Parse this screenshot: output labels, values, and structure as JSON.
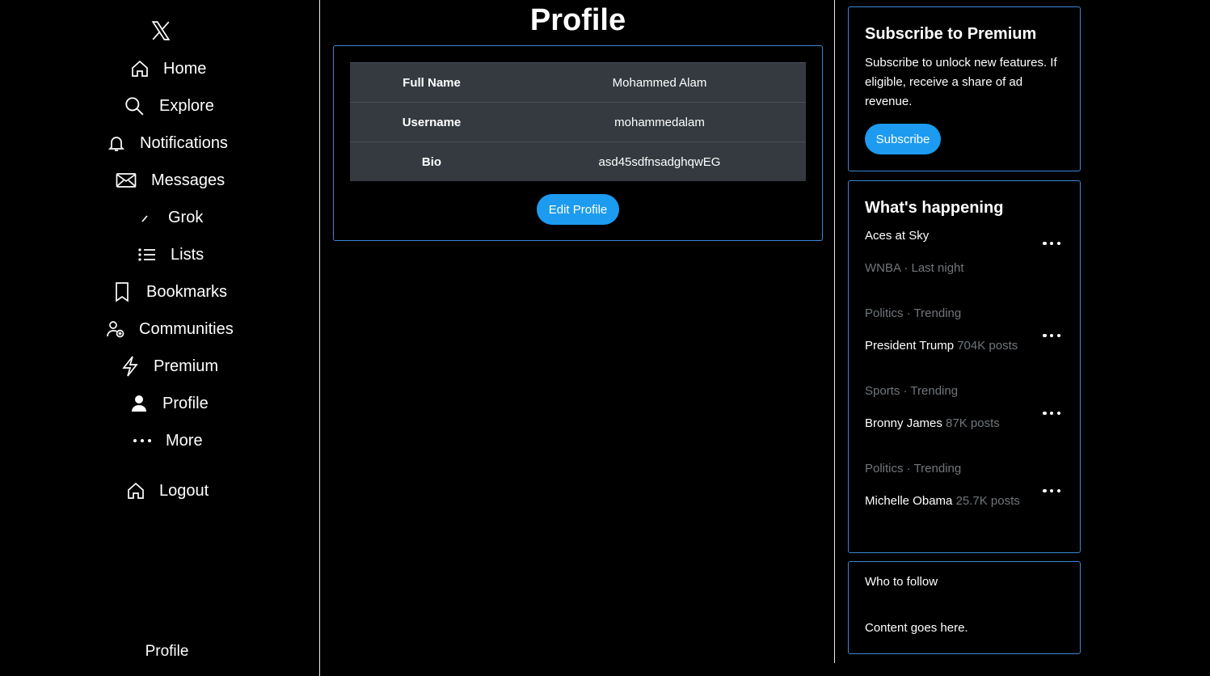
{
  "nav": {
    "items": [
      {
        "label": "Home",
        "icon": "home-icon"
      },
      {
        "label": "Explore",
        "icon": "search-icon"
      },
      {
        "label": "Notifications",
        "icon": "bell-icon"
      },
      {
        "label": "Messages",
        "icon": "envelope-icon"
      },
      {
        "label": "Grok",
        "icon": "grok-icon"
      },
      {
        "label": "Lists",
        "icon": "list-icon"
      },
      {
        "label": "Bookmarks",
        "icon": "bookmark-icon"
      },
      {
        "label": "Communities",
        "icon": "communities-icon"
      },
      {
        "label": "Premium",
        "icon": "lightning-icon"
      },
      {
        "label": "Profile",
        "icon": "person-icon"
      },
      {
        "label": "More",
        "icon": "more-dots-icon"
      }
    ],
    "logout": {
      "label": "Logout",
      "icon": "home-icon"
    },
    "footer": "Profile"
  },
  "main": {
    "title": "Profile",
    "profile": [
      {
        "key": "Full Name",
        "value": "Mohammed Alam"
      },
      {
        "key": "Username",
        "value": "mohammedalam"
      },
      {
        "key": "Bio",
        "value": "asd45sdfnsadghqwEG"
      }
    ],
    "edit_label": "Edit Profile"
  },
  "premium": {
    "title": "Subscribe to Premium",
    "text": "Subscribe to unlock new features. If eligible, receive a share of ad revenue.",
    "button": "Subscribe"
  },
  "happening": {
    "title": "What's happening",
    "first_topic": "Aces at Sky",
    "first_meta": "WNBA · Last night",
    "trends": [
      {
        "category": "Politics · Trending",
        "name": "President Trump",
        "count": "704K posts"
      },
      {
        "category": "Sports · Trending",
        "name": "Bronny James",
        "count": "87K posts"
      },
      {
        "category": "Politics · Trending",
        "name": "Michelle Obama",
        "count": "25.7K posts"
      }
    ]
  },
  "follow": {
    "title": "Who to follow",
    "content": "Content goes here."
  },
  "colors": {
    "accent": "#1d9bf0",
    "border": "#3b86d6",
    "table_bg": "#343a40",
    "muted": "#71767b"
  }
}
